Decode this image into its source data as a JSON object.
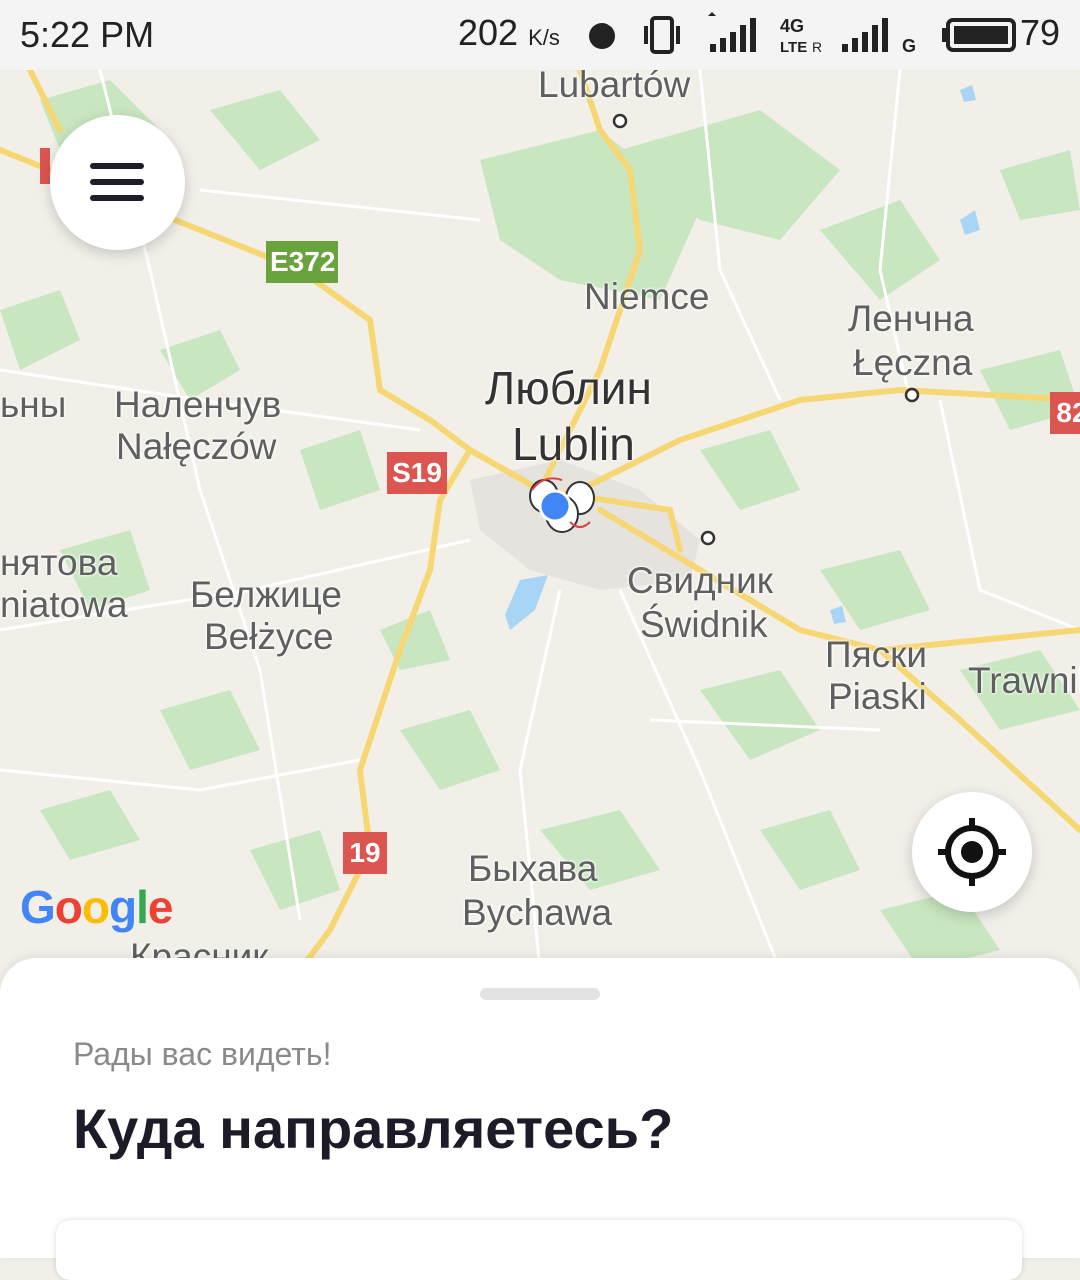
{
  "status_bar": {
    "time": "5:22 PM",
    "speed_value": "202",
    "speed_unit": "K/s",
    "net_label": "4G",
    "net_sub": "LTE",
    "battery": "79"
  },
  "map": {
    "labels": {
      "lubartow": "Lubartów",
      "niemce": "Niemce",
      "lublin_ru": "Люблин",
      "lublin": "Lublin",
      "leczna_ru": "Ленчна",
      "leczna": "Łęczna",
      "naleczow_ru": "Наленчув",
      "naleczow": "Nałęczów",
      "ny_partial": "ьны",
      "poniatowa_ru": "нятова",
      "poniatowa": "niatowa",
      "belzyce_ru": "Белжице",
      "belzyce": "Bełżyce",
      "swidnik_ru": "Свидник",
      "swidnik": "Świdnik",
      "piaski_ru": "Пяски",
      "piaski": "Piaski",
      "trawniki": "Trawnil",
      "bychawa_ru": "Быхава",
      "bychawa": "Bychawa",
      "krasnik_partial": "Красник"
    },
    "shields": {
      "e372": "E372",
      "s19": "S19",
      "r19": "19",
      "r82": "82"
    },
    "google_logo": "Google",
    "colors": {
      "land": "#f2efe9",
      "forest": "#c8e6c0",
      "road": "#f6d774",
      "water": "#a8d5f5",
      "shield_red": "#dd5550",
      "shield_green": "#6aa23e",
      "location_dot": "#4285f4"
    }
  },
  "buttons": {
    "menu_icon": "hamburger-icon",
    "locate_icon": "crosshair-icon"
  },
  "sheet": {
    "greeting": "Рады вас видеть!",
    "question": "Куда направляетесь?"
  }
}
